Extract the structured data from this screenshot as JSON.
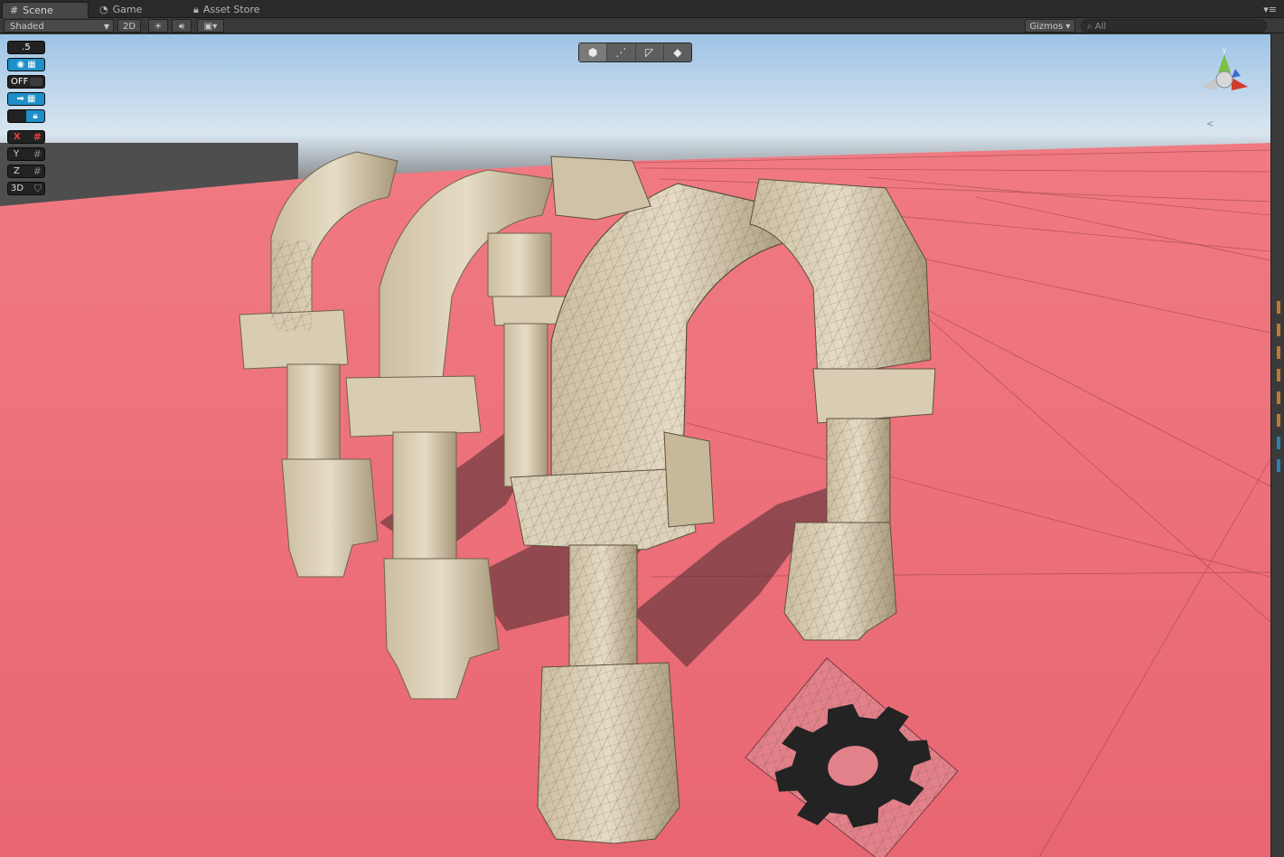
{
  "tabs": [
    {
      "label": "Scene",
      "active": true
    },
    {
      "label": "Game",
      "active": false
    },
    {
      "label": "Asset Store",
      "active": false
    }
  ],
  "toolbar": {
    "shading_mode": "Shaded",
    "mode_2d": "2D",
    "gizmos_label": "Gizmos",
    "search_placeholder": "All"
  },
  "overlay": {
    "snap_value": ".5",
    "toggle_off": "OFF",
    "axis_x": "X",
    "axis_y": "Y",
    "axis_z": "Z",
    "mode_3d": "3D"
  },
  "colors": {
    "ground": "#e8747c",
    "stone": "#d7cbb3",
    "sky_top": "#9ec3e6",
    "accent": "#1d8fc9"
  },
  "icons": {
    "scene_tab": "grid-icon",
    "game_tab": "pacman-icon",
    "store_tab": "lock-icon",
    "gear_decal": "gear-icon",
    "scene_gizmo": "axis-gizmo-icon"
  }
}
